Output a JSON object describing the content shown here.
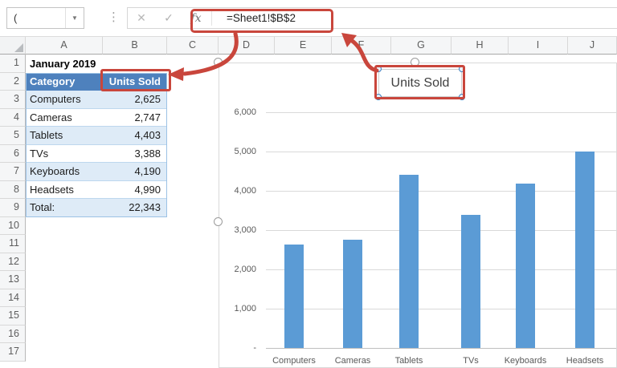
{
  "window": {
    "name_box_value": "(",
    "dropdown_arrow": "▼",
    "menu_dots": "⋮",
    "cancel_label": "✕",
    "enter_label": "✓",
    "fx_label": "fx",
    "formula": "=Sheet1!$B$2"
  },
  "sheet": {
    "column_headers": [
      "A",
      "B",
      "C",
      "D",
      "E",
      "F",
      "G",
      "H",
      "I",
      "J"
    ],
    "row_headers": [
      "1",
      "2",
      "3",
      "4",
      "5",
      "6",
      "7",
      "8",
      "9",
      "10",
      "11",
      "12",
      "13",
      "14",
      "15",
      "16",
      "17"
    ],
    "title_cell": "January 2019",
    "table": {
      "header": [
        "Category",
        "Units Sold"
      ],
      "rows": [
        [
          "Computers",
          "2,625"
        ],
        [
          "Cameras",
          "2,747"
        ],
        [
          "Tablets",
          "4,403"
        ],
        [
          "TVs",
          "3,388"
        ],
        [
          "Keyboards",
          "4,190"
        ],
        [
          "Headsets",
          "4,990"
        ],
        [
          "Total:",
          "22,343"
        ]
      ]
    }
  },
  "chart_data": {
    "type": "bar",
    "title": "Units Sold",
    "categories": [
      "Computers",
      "Cameras",
      "Tablets",
      "TVs",
      "Keyboards",
      "Headsets"
    ],
    "values": [
      2625,
      2747,
      4403,
      3388,
      4190,
      4990
    ],
    "series_formula": "=Sheet1!$B$2",
    "y_tick_values": [
      6000,
      5000,
      4000,
      3000,
      2000,
      1000,
      0
    ],
    "y_tick_labels": [
      "6,000",
      "5,000",
      "4,000",
      "3,000",
      "2,000",
      "1,000",
      "-"
    ],
    "ylim": [
      0,
      6000
    ],
    "grid": true,
    "legend_position": "none",
    "bar_color": "#5b9bd5"
  },
  "colors": {
    "annotation_red": "#c9463c",
    "table_header_bg": "#4e81bd",
    "band_fill": "#deebf7",
    "bar_fill": "#5b9bd5"
  }
}
